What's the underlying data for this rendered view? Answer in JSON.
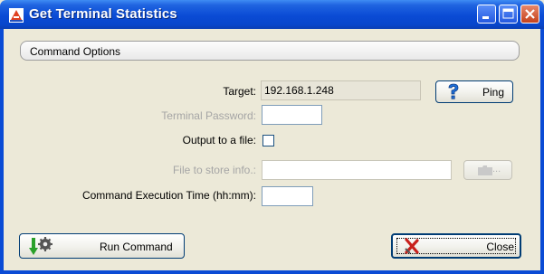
{
  "window": {
    "title": "Get Terminal Statistics"
  },
  "group": {
    "title": "Command Options"
  },
  "fields": {
    "target_label": "Target:",
    "target_value": "192.168.1.248",
    "password_label": "Terminal Password:",
    "password_value": "",
    "output_label": "Output to a file:",
    "output_checked": false,
    "file_label": "File to store info.:",
    "file_value": "",
    "exec_time_label": "Command Execution Time (hh:mm):",
    "exec_time_value": ""
  },
  "buttons": {
    "ping": "Ping",
    "browse_dots": "...",
    "run": "Run Command",
    "close": "Close"
  },
  "icons": {
    "app": "app-icon",
    "ping": "help-question-icon",
    "browse": "folder-icon",
    "run": "run-command-gear-icon",
    "close": "red-x-close-icon"
  },
  "colors": {
    "titlebar": "#0a4bd5",
    "dialog_bg": "#ece9d8",
    "disabled_text": "#a5a5a5"
  }
}
